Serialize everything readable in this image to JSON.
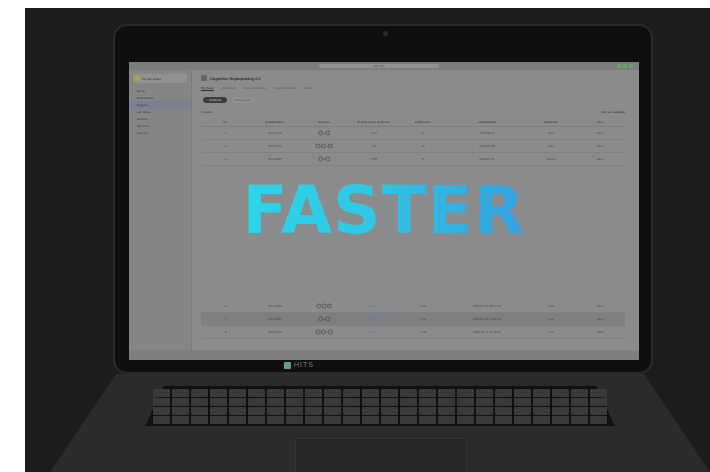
{
  "app": {
    "url": "app.xxxx",
    "workspace": "My Lab Space",
    "nav": [
      "Home",
      "Dashboards",
      "Projects",
      "Lab Notes",
      "Reports",
      "Members",
      "Security"
    ],
    "active_nav_index": 2,
    "project_title": "Cognitive Repurposing 2.0",
    "tabs": [
      "My Board",
      "Molecules",
      "Protein Structure",
      "Target Prediction",
      "Board"
    ],
    "active_tab_index": 0,
    "pill_active": "Scaffolds",
    "pill_inactive": "Compounds",
    "results_label": "3 results",
    "filter_label": "Add new scaffolds",
    "columns": [
      "No.",
      "Scaffold Name",
      "Structure",
      "Binding Score (kcal/mol)",
      "# Molecules",
      "Last Modified",
      "Added By",
      "More"
    ],
    "rows": [
      {
        "no": "1",
        "name": "SKF-0120",
        "structure": "⌬-⌬",
        "score": "-10.2",
        "count": "12",
        "date": "2023-08-11",
        "by": "Wen",
        "more": "More"
      },
      {
        "no": "2",
        "name": "SKF-0071",
        "structure": "⌬⌬-⌬",
        "score": "-9.6",
        "count": "10",
        "date": "2023-07-30",
        "by": "Han",
        "more": "More"
      },
      {
        "no": "3",
        "name": "SKF-0045",
        "structure": "⌬-⌬",
        "score": "-7.88",
        "count": "8",
        "date": "2023-07-22",
        "by": "Daniel",
        "more": "More"
      }
    ],
    "lower_rows": [
      {
        "no": "6",
        "name": "SKF-0055",
        "structure": "⌬⌬⌬",
        "ylink": "Done",
        "score": "-8.21",
        "date": "2023-07-21 09:27:08",
        "by": "Jane",
        "more": "More"
      },
      {
        "no": "7",
        "name": "SKF-0064",
        "structure": "⌬-⌬",
        "ylink": "Done",
        "score": "-7.50",
        "date": "2023-07-18 15:02:44",
        "by": "Lee",
        "more": "More"
      },
      {
        "no": "8",
        "name": "SKF-0123",
        "structure": "⌬⌬-⌬",
        "ylink": "Done",
        "score": "-7.02",
        "date": "2023-07-15 11:10:53",
        "by": "Lee",
        "more": "More"
      }
    ],
    "selected_lower_row_index": 1
  },
  "overlay_text": "FASTER",
  "brand": "HITS",
  "colors": {
    "overlay_start": "#2ae0ea",
    "overlay_end": "#3b84da",
    "workspace_icon": "#b0a52e",
    "brand_icon": "#5f9e8f"
  }
}
